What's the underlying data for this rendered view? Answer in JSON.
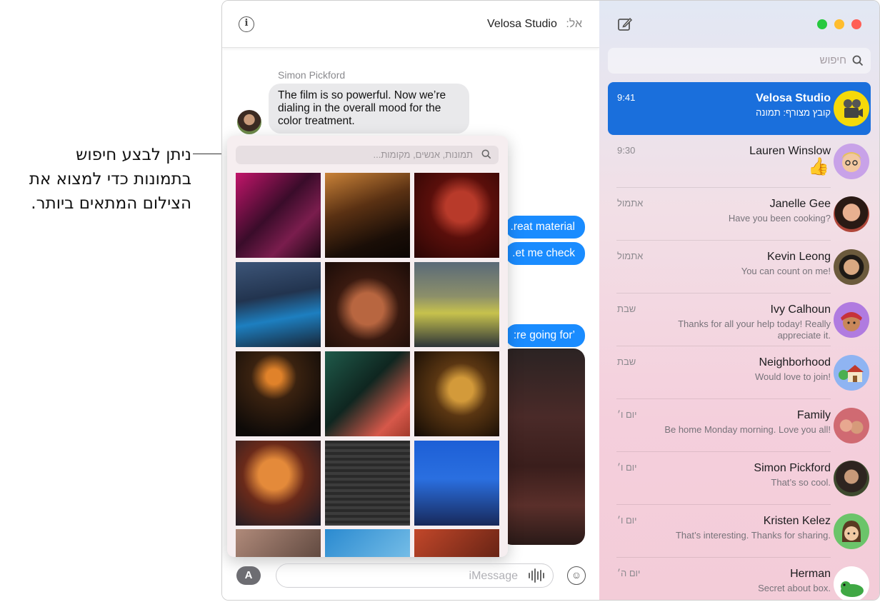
{
  "callout": {
    "line1": "ניתן לבצע חיפוש",
    "line2": "בתמונות כדי למצוא את",
    "line3": "הצילום המתאים ביותר."
  },
  "conversation": {
    "to_label": "אל:",
    "to_name": "Velosa Studio",
    "sender_name": "Simon Pickford",
    "incoming_message": "The film is so powerful. Now we’re dialing in the overall mood for the color treatment.",
    "outgoing_partial": [
      "reat material.",
      "et me check.",
      "’re going for:"
    ]
  },
  "photos_picker": {
    "search_placeholder": "תמונות, אנשים, מקומות...",
    "photo_count": 15
  },
  "compose": {
    "placeholder": "iMessage",
    "appstore_label": "A"
  },
  "sidebar": {
    "search_placeholder": "חיפוש",
    "conversations": [
      {
        "name": "Velosa Studio",
        "time": "9:41",
        "preview": "קובץ מצורף:  תמונה",
        "selected": true,
        "avatar": "film-camera-avatar",
        "color": "#f5d90a"
      },
      {
        "name": "Lauren Winslow",
        "time": "9:30",
        "preview": "👍",
        "avatar": "memoji-avatar",
        "color": "#c8a2e8"
      },
      {
        "name": "Janelle Gee",
        "time": "אתמול",
        "preview": "Have you been cooking?",
        "avatar": "photo-avatar",
        "color": "#b0473a"
      },
      {
        "name": "Kevin Leong",
        "time": "אתמול",
        "preview": "You can count on me!",
        "avatar": "photo-avatar",
        "color": "#6b5a3c"
      },
      {
        "name": "Ivy Calhoun",
        "time": "שבת",
        "preview": "Thanks for all your help today! Really appreciate it.",
        "avatar": "memoji-avatar",
        "color": "#b07be0"
      },
      {
        "name": "Neighborhood",
        "time": "שבת",
        "preview": "Would love to join!",
        "avatar": "house-avatar",
        "color": "#8fb4f2"
      },
      {
        "name": "Family",
        "time": "יום ו׳",
        "preview": "Be home Monday morning. Love you all!",
        "avatar": "photo-avatar",
        "color": "#d06a72"
      },
      {
        "name": "Simon Pickford",
        "time": "יום ו׳",
        "preview": "That’s so cool.",
        "avatar": "photo-avatar",
        "color": "#3e4a2e"
      },
      {
        "name": "Kristen Kelez",
        "time": "יום ו׳",
        "preview": "That’s interesting. Thanks for sharing.",
        "avatar": "memoji-avatar",
        "color": "#6bc46a"
      },
      {
        "name": "Herman",
        "time": "יום ה׳",
        "preview": "Secret about box.",
        "avatar": "lizard-avatar",
        "color": "#ffffff"
      }
    ]
  },
  "colors": {
    "accent": "#1a8cff",
    "selected_row": "#1a6fdc",
    "traffic_green": "#27c93f",
    "traffic_yellow": "#ffbd2e",
    "traffic_red": "#ff5f56"
  }
}
